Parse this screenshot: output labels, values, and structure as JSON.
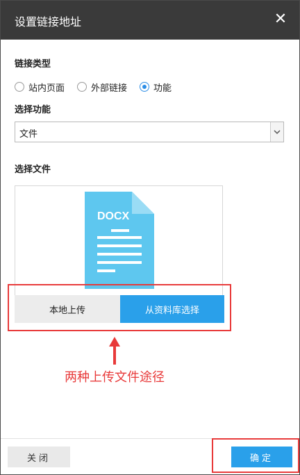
{
  "dialog": {
    "title": "设置链接地址",
    "close_icon": "close-icon"
  },
  "link_type": {
    "label": "链接类型",
    "options": [
      {
        "label": "站内页面",
        "checked": false
      },
      {
        "label": "外部链接",
        "checked": false
      },
      {
        "label": "功能",
        "checked": true
      }
    ]
  },
  "function": {
    "label": "选择功能",
    "selected": "文件"
  },
  "file": {
    "label": "选择文件",
    "doc_badge": "DOCX",
    "local_upload": "本地上传",
    "library_select": "从资料库选择"
  },
  "annotation": {
    "text": "两种上传文件途径",
    "color": "#e83a3a"
  },
  "footer": {
    "close_label": "关闭",
    "ok_label": "确定"
  },
  "colors": {
    "accent": "#2aa0ea",
    "titlebar": "#3a3a3a",
    "doc_icon": "#5ec7ef"
  }
}
